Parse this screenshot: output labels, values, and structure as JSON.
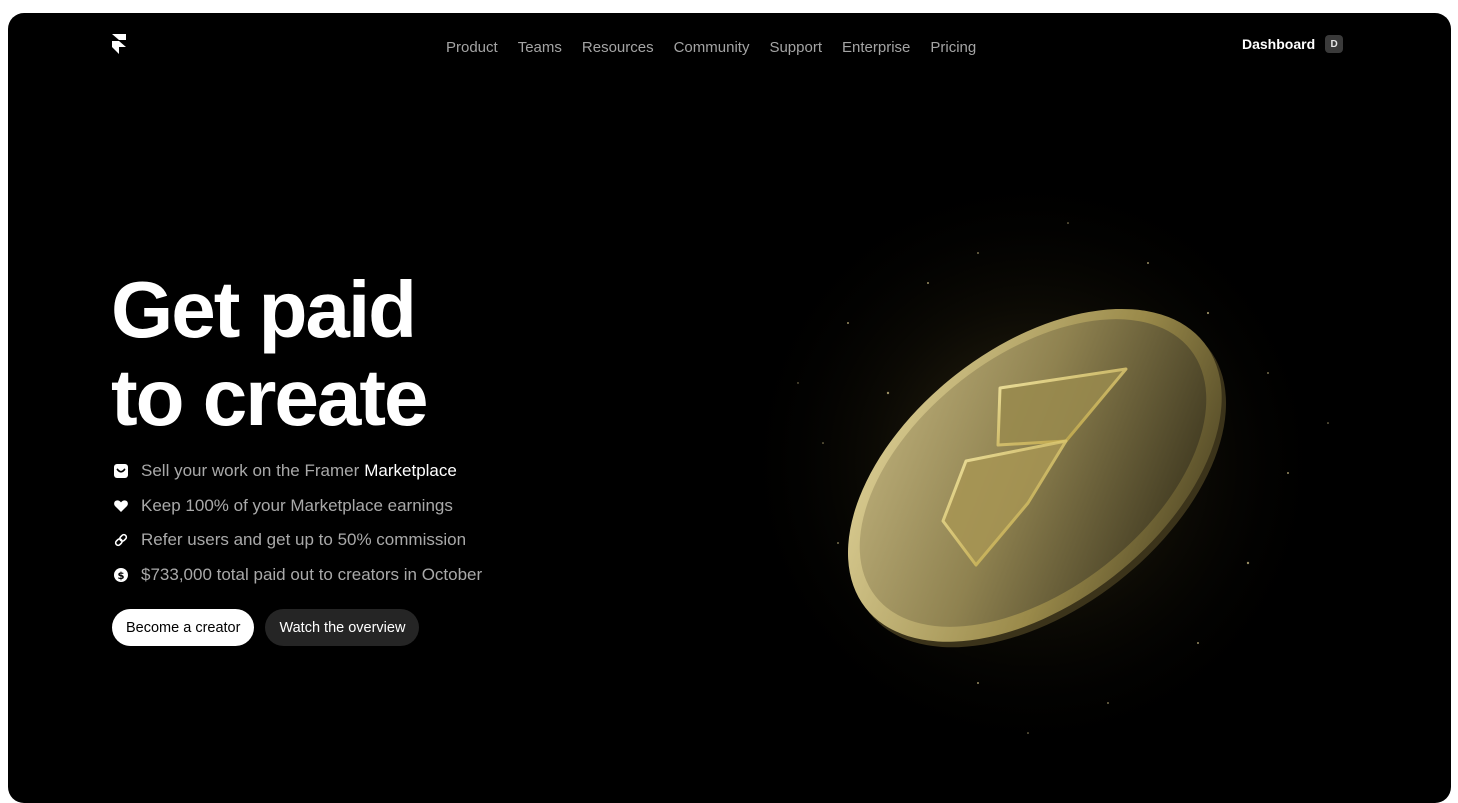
{
  "nav": {
    "items": [
      "Product",
      "Teams",
      "Resources",
      "Community",
      "Support",
      "Enterprise",
      "Pricing"
    ],
    "dashboard_label": "Dashboard",
    "avatar_initial": "D"
  },
  "hero": {
    "title_line1": "Get paid",
    "title_line2": "to create",
    "features": [
      {
        "icon": "store-icon",
        "text": "Sell your work on the Framer",
        "highlight": "Marketplace"
      },
      {
        "icon": "heart-icon",
        "text": "Keep 100% of your Marketplace earnings",
        "highlight": ""
      },
      {
        "icon": "link-icon",
        "text": "Refer users and get up to 50% commission",
        "highlight": ""
      },
      {
        "icon": "dollar-coin-icon",
        "text": "$733,000 total paid out to creators in October",
        "highlight": ""
      }
    ],
    "primary_button": "Become a creator",
    "secondary_button": "Watch the overview"
  },
  "colors": {
    "background": "#000000",
    "nav_text": "#a4a4a4",
    "coin_gold": "#c9b77a"
  }
}
